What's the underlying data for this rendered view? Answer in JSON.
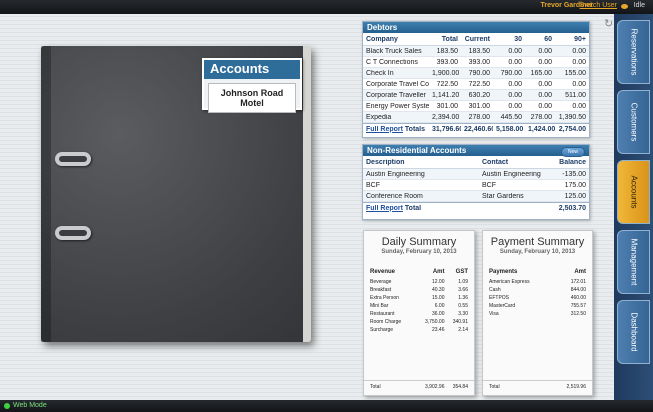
{
  "header": {
    "user": "Trevor Gardiner",
    "switch_user": "Switch User",
    "status": "Idle"
  },
  "binder": {
    "label_title": "Accounts",
    "label_name": "Johnson Road Motel"
  },
  "debtors": {
    "title": "Debtors",
    "columns": [
      "Company",
      "Total",
      "Current",
      "30",
      "60",
      "90+"
    ],
    "rows": [
      [
        "Black Truck Sales",
        "183.50",
        "183.50",
        "0.00",
        "0.00",
        "0.00"
      ],
      [
        "C T Connections",
        "393.00",
        "393.00",
        "0.00",
        "0.00",
        "0.00"
      ],
      [
        "Check In",
        "1,900.00",
        "790.00",
        "790.00",
        "165.00",
        "155.00"
      ],
      [
        "Corporate Travel Con...",
        "722.50",
        "722.50",
        "0.00",
        "0.00",
        "0.00"
      ],
      [
        "Corporate Traveller",
        "1,141.20",
        "630.20",
        "0.00",
        "0.00",
        "511.00"
      ],
      [
        "Energy Power Systems",
        "301.00",
        "301.00",
        "0.00",
        "0.00",
        "0.00"
      ],
      [
        "Expedia",
        "2,394.00",
        "278.00",
        "445.50",
        "278.00",
        "1,390.50"
      ]
    ],
    "footer": {
      "link": "Full Report",
      "label": "Totals",
      "values": [
        "31,796.60",
        "22,460.60",
        "5,158.00",
        "1,424.00",
        "2,754.00"
      ]
    }
  },
  "nonres": {
    "title": "Non-Residential Accounts",
    "new_label": "New",
    "columns": [
      "Description",
      "Contact",
      "Balance"
    ],
    "rows": [
      [
        "Austin Engineering",
        "Austin Engineering",
        "-135.00"
      ],
      [
        "BCF",
        "BCF",
        "175.00"
      ],
      [
        "Conference Room",
        "Star Gardens",
        "125.00"
      ]
    ],
    "footer": {
      "link": "Full Report",
      "label": "Total",
      "value": "2,503.70"
    }
  },
  "daily": {
    "title": "Daily Summary",
    "date": "Sunday, February 10, 2013",
    "columns": [
      "Revenue",
      "Amt",
      "GST"
    ],
    "rows": [
      [
        "Beverage",
        "12.00",
        "1.09"
      ],
      [
        "Breakfast",
        "40.30",
        "3.66"
      ],
      [
        "Extra Person",
        "15.00",
        "1.36"
      ],
      [
        "Mini Bar",
        "6.00",
        "0.55"
      ],
      [
        "Restaurant",
        "36.00",
        "3.30"
      ],
      [
        "Room Charge",
        "3,750.00",
        "340.91"
      ],
      [
        "Surcharge",
        "23.46",
        "2.14"
      ]
    ],
    "total": [
      "Total",
      "3,902.96",
      "354.84"
    ]
  },
  "payment": {
    "title": "Payment Summary",
    "date": "Sunday, February 10, 2013",
    "columns": [
      "Payments",
      "Amt"
    ],
    "rows": [
      [
        "American Express",
        "172.01"
      ],
      [
        "Cash",
        "844.00"
      ],
      [
        "EFTPOS",
        "460.00"
      ],
      [
        "MasterCard",
        "755.57"
      ],
      [
        "Visa",
        "312.50"
      ]
    ],
    "total": [
      "Total",
      "2,519.96"
    ]
  },
  "tabs": [
    "Reservations",
    "Customers",
    "Accounts",
    "Management",
    "Dashboard"
  ],
  "active_tab": "Accounts",
  "status_bar": {
    "mode": "Web Mode"
  },
  "colors": {
    "accent": "#e6a62a",
    "panel_header": "#2e6c9a",
    "tab_active": "#f1b737"
  }
}
